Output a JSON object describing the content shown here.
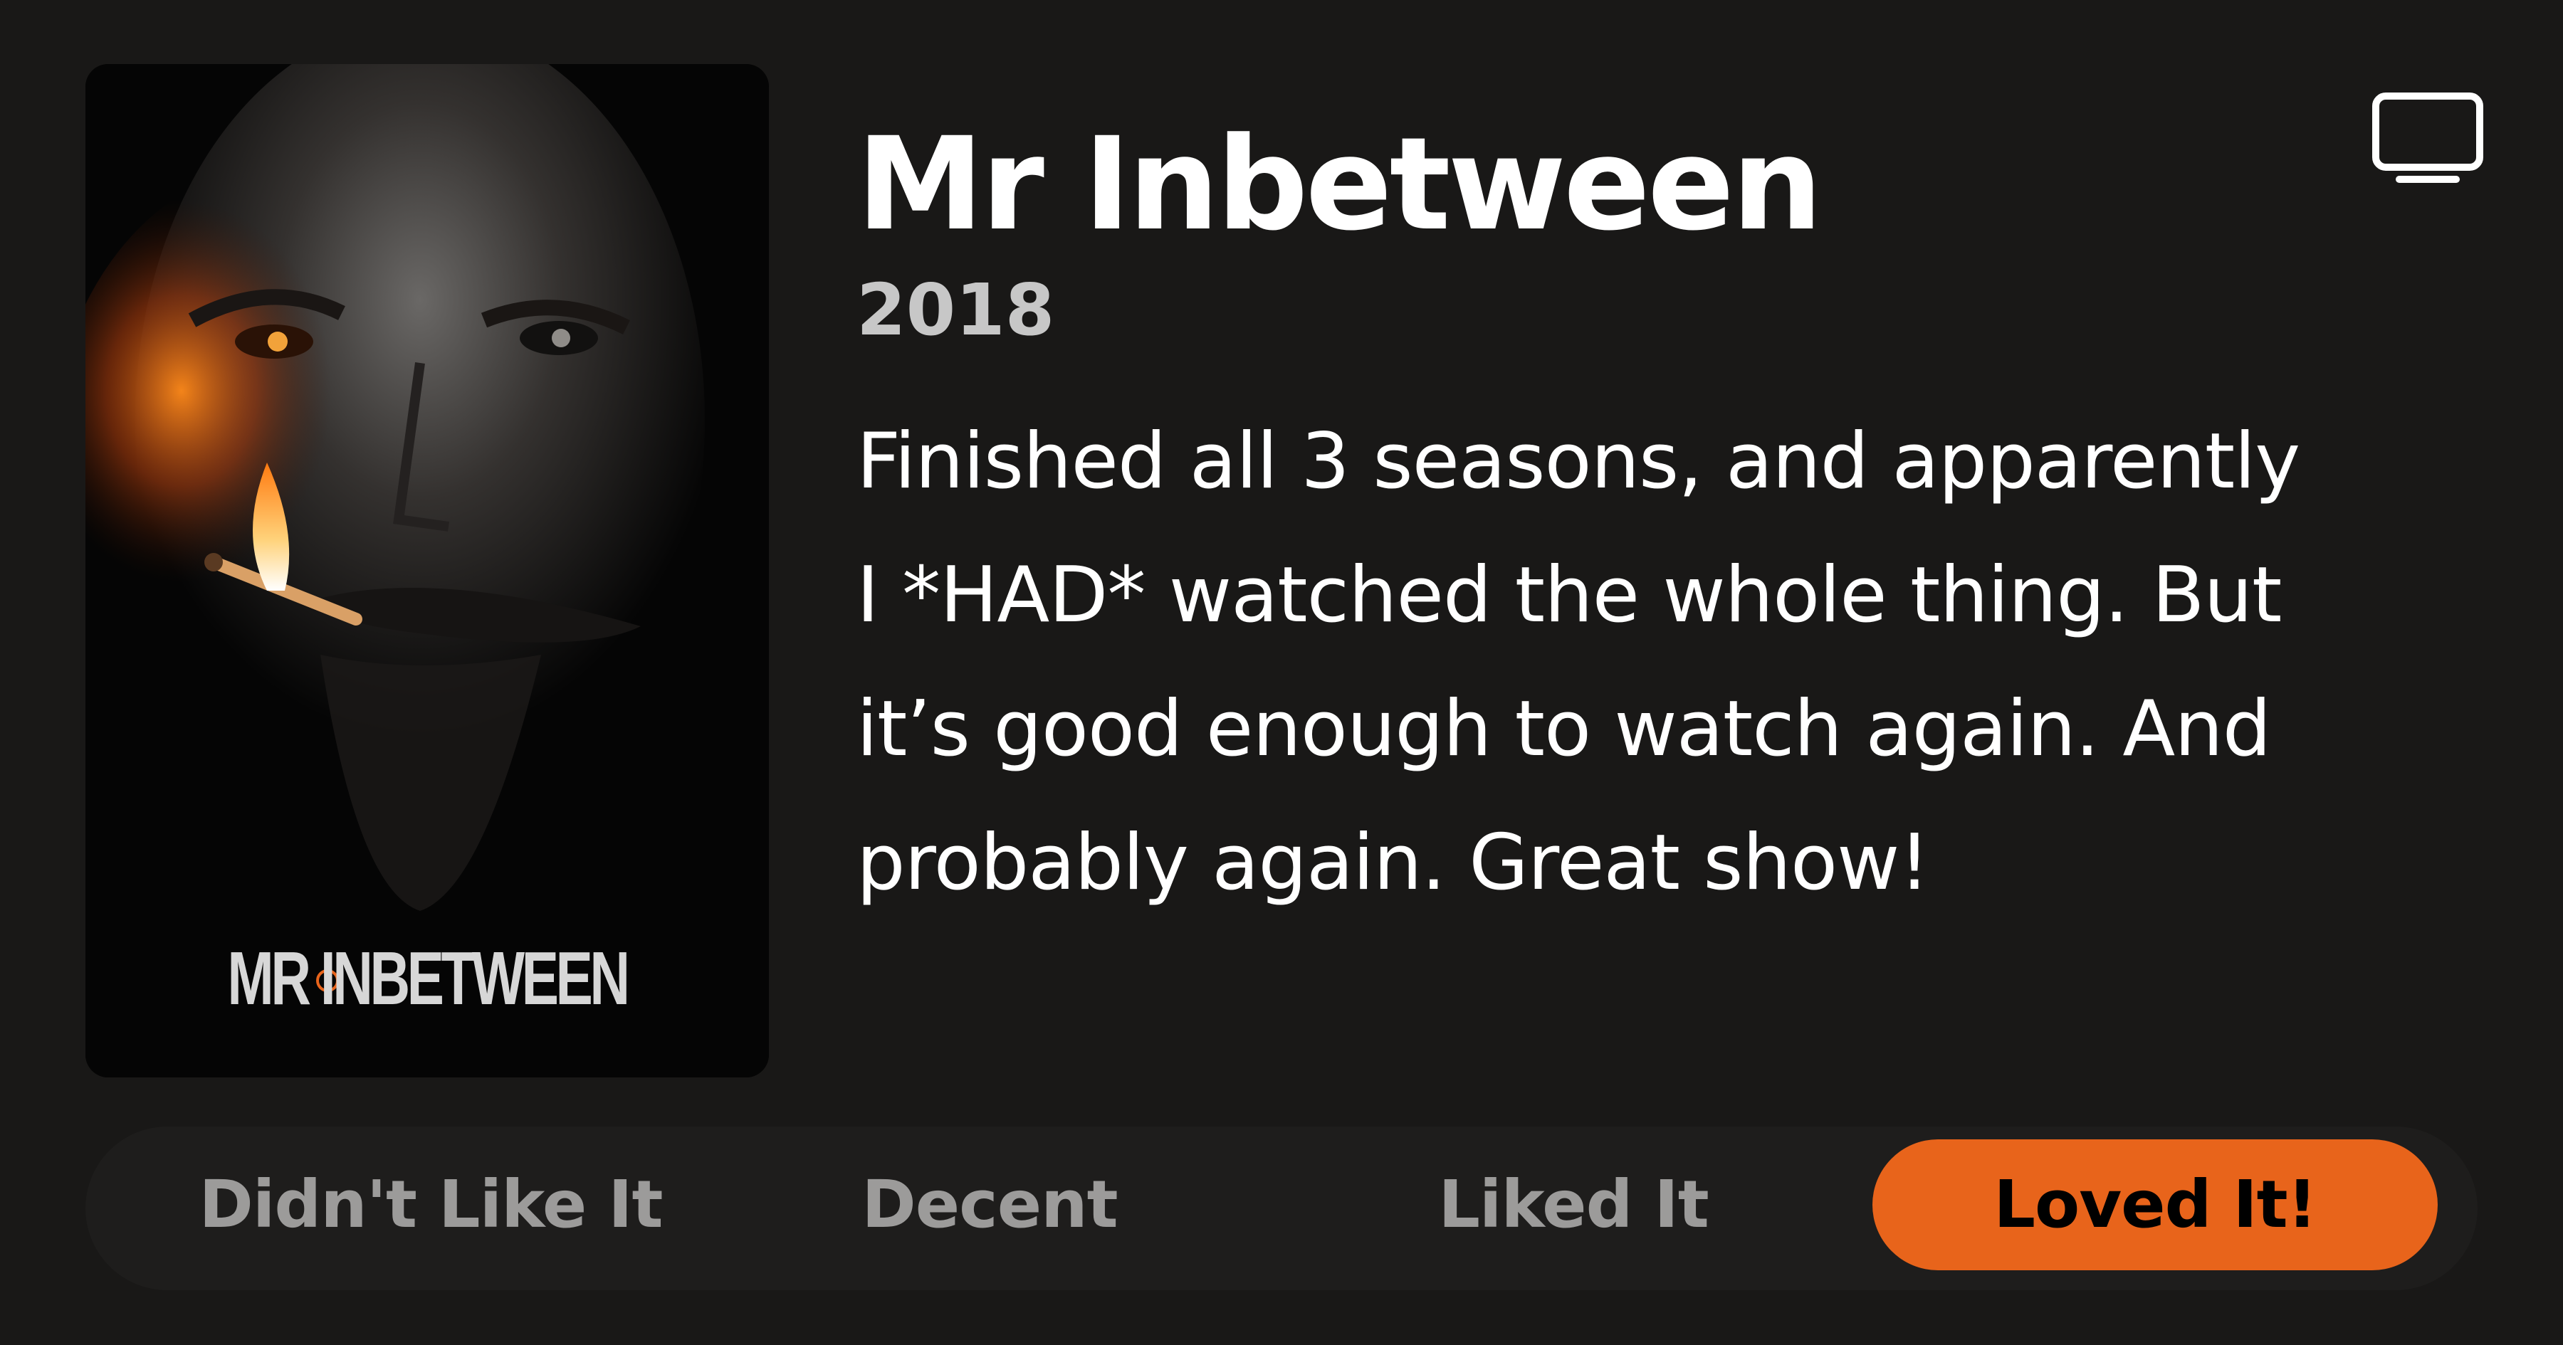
{
  "show": {
    "title": "Mr Inbetween",
    "year": "2018",
    "poster_logo_text": "MR INBETWEEN"
  },
  "review": {
    "lines": [
      "Finished all 3 seasons, and apparently",
      "I *HAD* watched the whole thing. But",
      "it’s good enough to watch again. And",
      "probably again. Great show!"
    ]
  },
  "media_type_icon": "tv-icon",
  "rating": {
    "options": [
      {
        "label": "Didn't Like It",
        "selected": false
      },
      {
        "label": "Decent",
        "selected": false
      },
      {
        "label": "Liked It",
        "selected": false
      },
      {
        "label": "Loved It!",
        "selected": true
      }
    ],
    "accent_color": "#e8641b"
  },
  "colors": {
    "background": "#191817",
    "bar": "#1e1d1c"
  }
}
